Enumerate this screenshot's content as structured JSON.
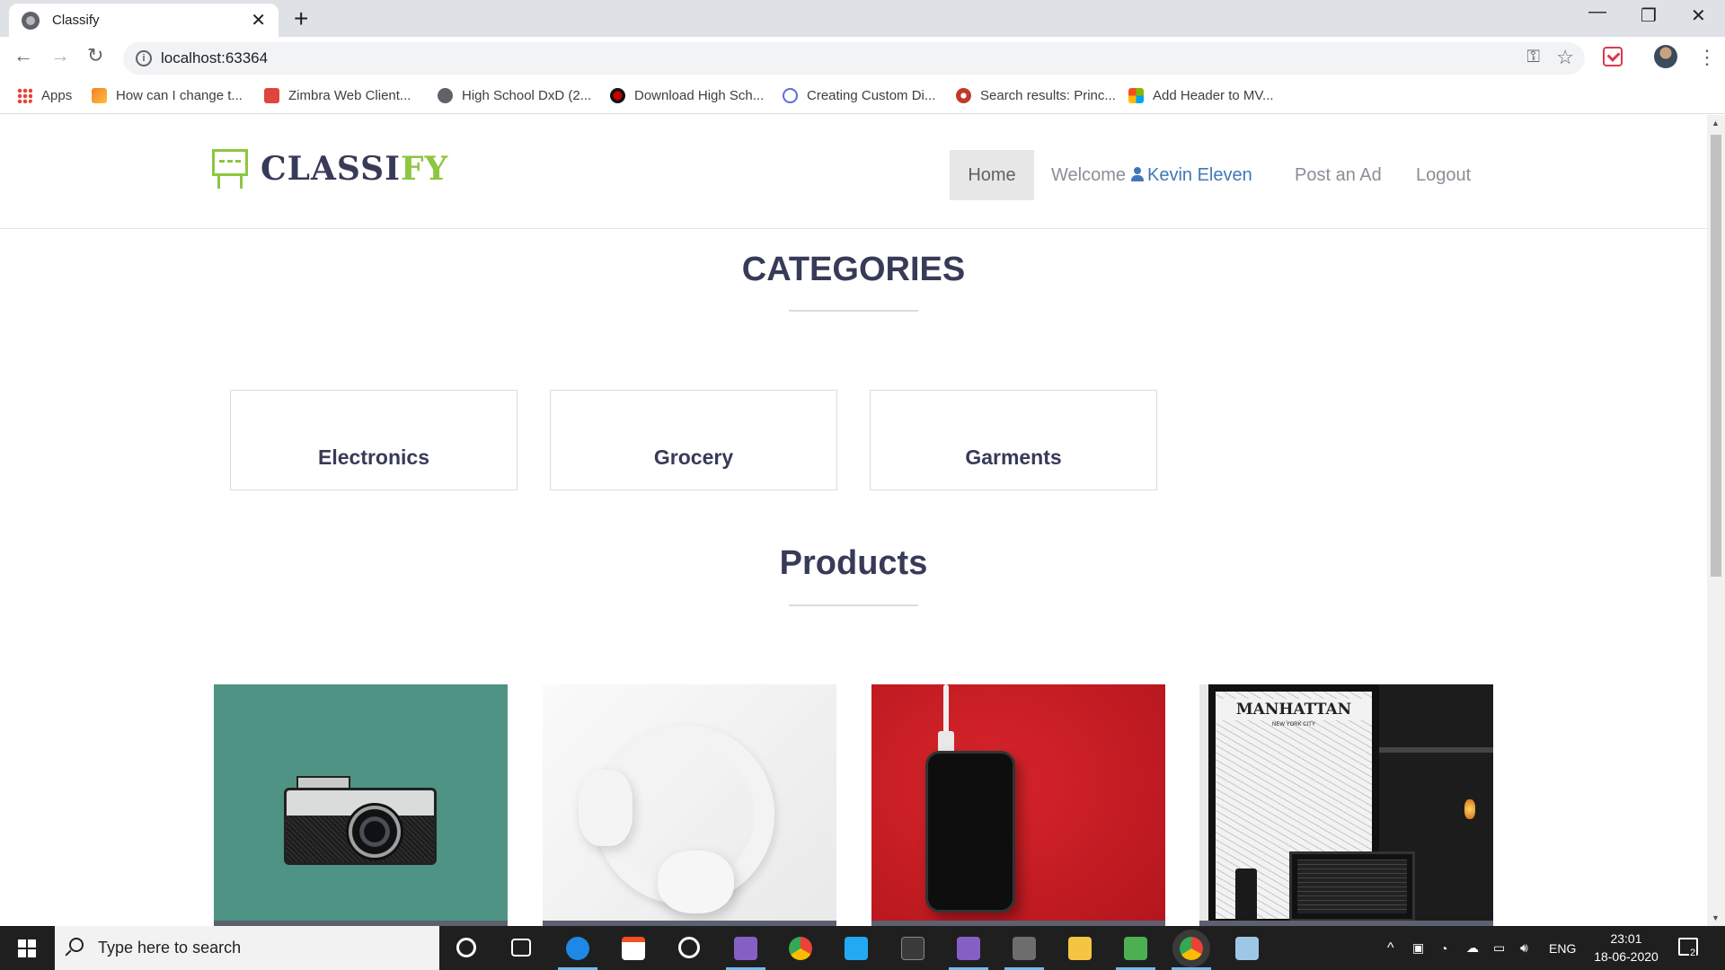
{
  "browser": {
    "tab_title": "Classify",
    "url": "localhost:63364",
    "bookmarks": [
      "Apps",
      "How can I change t...",
      "Zimbra Web Client...",
      "High School DxD (2...",
      "Download High Sch...",
      "Creating Custom Di...",
      "Search results: Princ...",
      "Add Header to MV..."
    ]
  },
  "site": {
    "logo_main": "CLASSI",
    "logo_accent": "FY",
    "nav": {
      "home": "Home",
      "welcome": "Welcome",
      "user": "Kevin Eleven",
      "post_ad": "Post an Ad",
      "logout": "Logout"
    },
    "categories_title": "CATEGORIES",
    "categories": [
      "Electronics",
      "Grocery",
      "Garments"
    ],
    "products_title": "Products",
    "products": [
      {
        "image": "camera"
      },
      {
        "image": "headphones"
      },
      {
        "image": "smartphone"
      },
      {
        "image": "desk-setup",
        "poster_title": "MANHATTAN",
        "poster_subtitle": "NEW YORK CITY"
      }
    ]
  },
  "taskbar": {
    "search_placeholder": "Type here to search",
    "language": "ENG",
    "time": "23:01",
    "date": "18-06-2020",
    "notification_count": "2"
  },
  "colors": {
    "brand_dark": "#373b58",
    "brand_green": "#8dc63f",
    "user_link": "#3f78b9"
  }
}
